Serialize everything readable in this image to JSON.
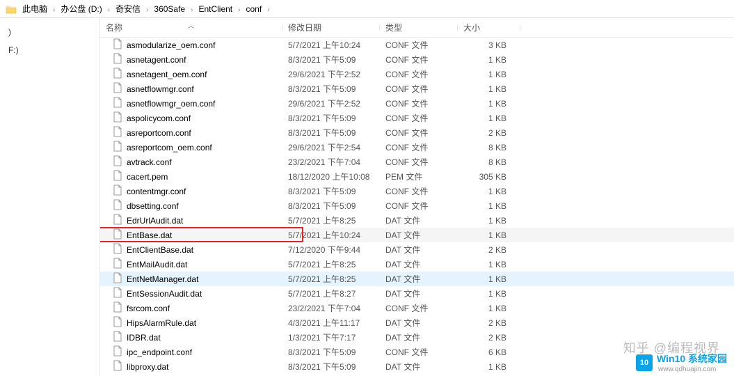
{
  "breadcrumb": [
    {
      "label": "此电脑"
    },
    {
      "label": "办公盘 (D:)"
    },
    {
      "label": "奇安信"
    },
    {
      "label": "360Safe"
    },
    {
      "label": "EntClient"
    },
    {
      "label": "conf"
    }
  ],
  "sidebar": [
    {
      "label": ""
    },
    {
      "label": ")"
    },
    {
      "label": ""
    },
    {
      "label": "F:)"
    }
  ],
  "columns": {
    "name": "名称",
    "date": "修改日期",
    "type": "类型",
    "size": "大小"
  },
  "files": [
    {
      "name": "asmodularize_oem.conf",
      "date": "5/7/2021 上午10:24",
      "type": "CONF 文件",
      "size": "3 KB"
    },
    {
      "name": "asnetagent.conf",
      "date": "8/3/2021 下午5:09",
      "type": "CONF 文件",
      "size": "1 KB"
    },
    {
      "name": "asnetagent_oem.conf",
      "date": "29/6/2021 下午2:52",
      "type": "CONF 文件",
      "size": "1 KB"
    },
    {
      "name": "asnetflowmgr.conf",
      "date": "8/3/2021 下午5:09",
      "type": "CONF 文件",
      "size": "1 KB"
    },
    {
      "name": "asnetflowmgr_oem.conf",
      "date": "29/6/2021 下午2:52",
      "type": "CONF 文件",
      "size": "1 KB"
    },
    {
      "name": "aspolicycom.conf",
      "date": "8/3/2021 下午5:09",
      "type": "CONF 文件",
      "size": "1 KB"
    },
    {
      "name": "asreportcom.conf",
      "date": "8/3/2021 下午5:09",
      "type": "CONF 文件",
      "size": "2 KB"
    },
    {
      "name": "asreportcom_oem.conf",
      "date": "29/6/2021 下午2:54",
      "type": "CONF 文件",
      "size": "8 KB"
    },
    {
      "name": "avtrack.conf",
      "date": "23/2/2021 下午7:04",
      "type": "CONF 文件",
      "size": "8 KB"
    },
    {
      "name": "cacert.pem",
      "date": "18/12/2020 上午10:08",
      "type": "PEM 文件",
      "size": "305 KB"
    },
    {
      "name": "contentmgr.conf",
      "date": "8/3/2021 下午5:09",
      "type": "CONF 文件",
      "size": "1 KB"
    },
    {
      "name": "dbsetting.conf",
      "date": "8/3/2021 下午5:09",
      "type": "CONF 文件",
      "size": "1 KB"
    },
    {
      "name": "EdrUrlAudit.dat",
      "date": "5/7/2021 上午8:25",
      "type": "DAT 文件",
      "size": "1 KB"
    },
    {
      "name": "EntBase.dat",
      "date": "5/7/2021 上午10:24",
      "type": "DAT 文件",
      "size": "1 KB",
      "redbox": true
    },
    {
      "name": "EntClientBase.dat",
      "date": "7/12/2020 下午9:44",
      "type": "DAT 文件",
      "size": "2 KB"
    },
    {
      "name": "EntMailAudit.dat",
      "date": "5/7/2021 上午8:25",
      "type": "DAT 文件",
      "size": "1 KB"
    },
    {
      "name": "EntNetManager.dat",
      "date": "5/7/2021 上午8:25",
      "type": "DAT 文件",
      "size": "1 KB",
      "bluebox": true
    },
    {
      "name": "EntSessionAudit.dat",
      "date": "5/7/2021 上午8:27",
      "type": "DAT 文件",
      "size": "1 KB"
    },
    {
      "name": "fsrcom.conf",
      "date": "23/2/2021 下午7:04",
      "type": "CONF 文件",
      "size": "1 KB"
    },
    {
      "name": "HipsAlarmRule.dat",
      "date": "4/3/2021 上午11:17",
      "type": "DAT 文件",
      "size": "2 KB"
    },
    {
      "name": "IDBR.dat",
      "date": "1/3/2021 下午7:17",
      "type": "DAT 文件",
      "size": "2 KB"
    },
    {
      "name": "ipc_endpoint.conf",
      "date": "8/3/2021 下午5:09",
      "type": "CONF 文件",
      "size": "6 KB"
    },
    {
      "name": "libproxy.dat",
      "date": "8/3/2021 下午5:09",
      "type": "DAT 文件",
      "size": "1 KB"
    }
  ],
  "watermark": {
    "text1": "知乎 @编程视界",
    "logo": "10",
    "brand": "Win10 系统家园",
    "url": "www.qdhuajin.com"
  }
}
